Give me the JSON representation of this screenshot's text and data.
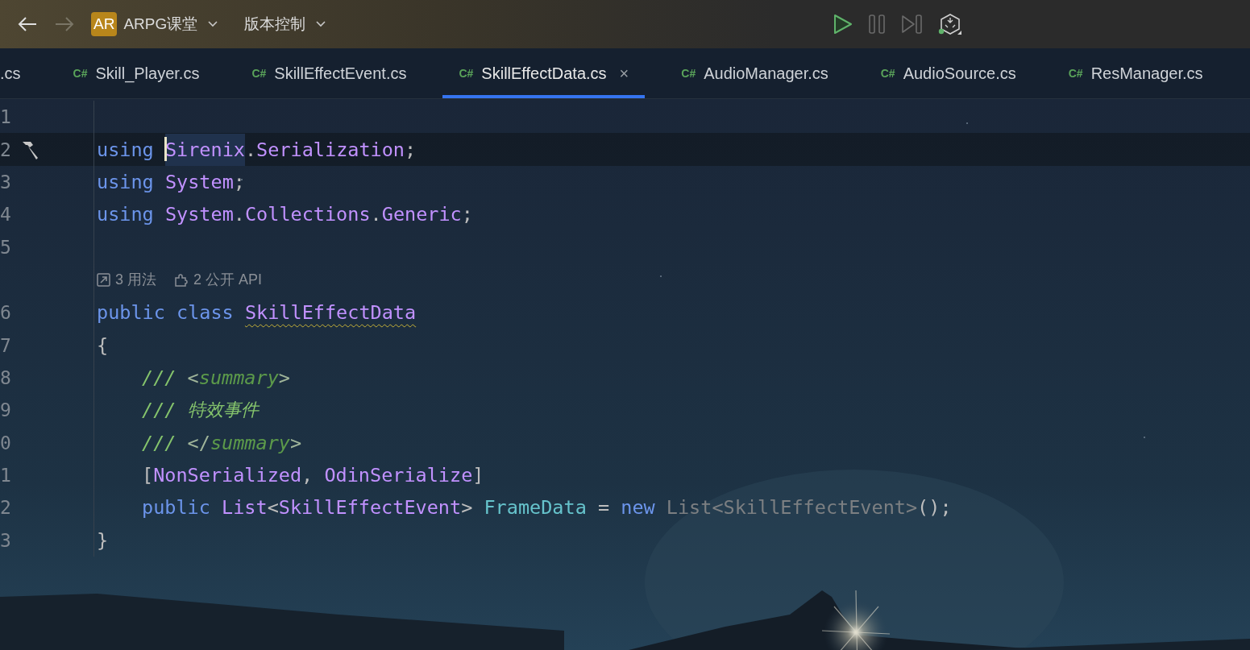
{
  "toolbar": {
    "back": {
      "disabled": false
    },
    "forward": {
      "disabled": true
    },
    "project": {
      "badge": "AR",
      "name": "ARPG课堂"
    },
    "vcs": {
      "label": "版本控制"
    }
  },
  "tabs": [
    {
      "label": ".cs",
      "selected": false
    },
    {
      "label": "Skill_Player.cs",
      "badge": "C#",
      "selected": false
    },
    {
      "label": "SkillEffectEvent.cs",
      "badge": "C#",
      "selected": false
    },
    {
      "label": "SkillEffectData.cs",
      "badge": "C#",
      "selected": true,
      "close": "×"
    },
    {
      "label": "AudioManager.cs",
      "badge": "C#",
      "selected": false
    },
    {
      "label": "AudioSource.cs",
      "badge": "C#",
      "selected": false
    },
    {
      "label": "ResManager.cs",
      "badge": "C#",
      "selected": false
    }
  ],
  "editor": {
    "lines": [
      {
        "kind": "code",
        "number": "1",
        "current": false,
        "action": false,
        "indented": false
      },
      {
        "kind": "code",
        "number": "2",
        "current": true,
        "action": true,
        "indented": false,
        "tokens": [
          {
            "text": "using",
            "kind": "keyword"
          },
          {
            "text": "Sirenix",
            "kind": "type",
            "highlighted": true,
            "space_before": true
          },
          {
            "text": ".",
            "kind": "punct"
          },
          {
            "text": "Serialization",
            "kind": "type"
          },
          {
            "text": ";",
            "kind": "punct"
          }
        ]
      },
      {
        "kind": "code",
        "number": "3",
        "current": false,
        "action": false,
        "indented": false,
        "tokens": [
          {
            "text": "using",
            "kind": "keyword"
          },
          {
            "text": "System",
            "kind": "type",
            "space_before": true
          },
          {
            "text": ";",
            "kind": "punct"
          }
        ]
      },
      {
        "kind": "code",
        "number": "4",
        "current": false,
        "action": false,
        "indented": false,
        "tokens": [
          {
            "text": "using",
            "kind": "keyword"
          },
          {
            "text": "System",
            "kind": "type",
            "space_before": true
          },
          {
            "text": ".",
            "kind": "punct"
          },
          {
            "text": "Collections",
            "kind": "type"
          },
          {
            "text": ".",
            "kind": "punct"
          },
          {
            "text": "Generic",
            "kind": "type"
          },
          {
            "text": ";",
            "kind": "punct"
          }
        ]
      },
      {
        "kind": "code",
        "number": "5",
        "current": false,
        "action": false,
        "indented": false
      },
      {
        "kind": "hint",
        "items": [
          {
            "text": "3 用法"
          },
          {
            "text": "2 公开 API"
          }
        ]
      },
      {
        "kind": "code",
        "number": "6",
        "current": false,
        "action": false,
        "indented": false,
        "tokens": [
          {
            "text": "public",
            "kind": "keyword"
          },
          {
            "text": "class",
            "kind": "keyword",
            "space_before": true
          },
          {
            "text": "SkillEffectData",
            "kind": "type",
            "warning": true,
            "space_before": true
          }
        ]
      },
      {
        "kind": "code",
        "number": "7",
        "current": false,
        "action": false,
        "indented": false,
        "tokens": [
          {
            "text": "{",
            "kind": "punct"
          }
        ]
      },
      {
        "kind": "code",
        "number": "8",
        "current": false,
        "action": false,
        "indented": true,
        "tokens": [
          {
            "text": "///",
            "kind": "docslash"
          },
          {
            "text": "<",
            "kind": "docbracket",
            "space_before": true
          },
          {
            "text": "summary",
            "kind": "doctag"
          },
          {
            "text": ">",
            "kind": "docbracket"
          }
        ]
      },
      {
        "kind": "code",
        "number": "9",
        "current": false,
        "action": false,
        "indented": true,
        "tokens": [
          {
            "text": "///",
            "kind": "docslash"
          },
          {
            "text": "特效事件",
            "kind": "doctext",
            "space_before": true
          }
        ]
      },
      {
        "kind": "code",
        "number": "0",
        "current": false,
        "action": false,
        "indented": true,
        "tokens": [
          {
            "text": "///",
            "kind": "docslash"
          },
          {
            "text": "</",
            "kind": "docbracket",
            "space_before": true
          },
          {
            "text": "summary",
            "kind": "doctag"
          },
          {
            "text": ">",
            "kind": "docbracket"
          }
        ]
      },
      {
        "kind": "code",
        "number": "1",
        "current": false,
        "action": false,
        "indented": true,
        "tokens": [
          {
            "text": "[",
            "kind": "punct"
          },
          {
            "text": "NonSerialized",
            "kind": "type"
          },
          {
            "text": ",",
            "kind": "punct"
          },
          {
            "text": "OdinSerialize",
            "kind": "type",
            "space_before": true
          },
          {
            "text": "]",
            "kind": "punct"
          }
        ]
      },
      {
        "kind": "code",
        "number": "2",
        "current": false,
        "action": false,
        "indented": true,
        "tokens": [
          {
            "text": "public",
            "kind": "keyword"
          },
          {
            "text": "List",
            "kind": "type",
            "space_before": true
          },
          {
            "text": "<",
            "kind": "punct"
          },
          {
            "text": "SkillEffectEvent",
            "kind": "type"
          },
          {
            "text": ">",
            "kind": "punct"
          },
          {
            "text": "FrameData",
            "kind": "field",
            "space_before": true
          },
          {
            "text": "=",
            "kind": "punct",
            "space_before": true
          },
          {
            "text": "new",
            "kind": "keyword",
            "space_before": true
          },
          {
            "text": "List<SkillEffectEvent>",
            "kind": "unused",
            "space_before": true
          },
          {
            "text": "();",
            "kind": "punct"
          }
        ]
      },
      {
        "kind": "code",
        "number": "3",
        "current": false,
        "action": false,
        "indented": false,
        "tokens": [
          {
            "text": "}",
            "kind": "punct"
          }
        ]
      }
    ]
  }
}
